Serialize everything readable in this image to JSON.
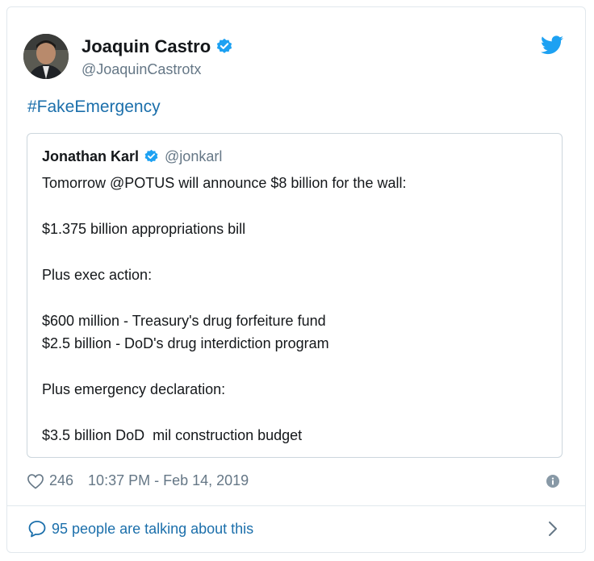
{
  "author": {
    "name": "Joaquin Castro",
    "handle": "@JoaquinCastrotx"
  },
  "tweet_text": "#FakeEmergency",
  "quoted": {
    "name": "Jonathan Karl",
    "handle": "@jonkarl",
    "lines": [
      "Tomorrow @POTUS will announce $8 billion for the wall:",
      "$1.375 billion appropriations bill",
      "Plus exec action:",
      "$600 million - Treasury's drug forfeiture fund",
      "$2.5 billion - DoD's drug interdiction program",
      "Plus emergency declaration:",
      "$3.5 billion DoD  mil construction budget"
    ]
  },
  "likes": "246",
  "timestamp": "10:37 PM - Feb 14, 2019",
  "talking": "95 people are talking about this",
  "colors": {
    "link": "#1b6fab",
    "verified": "#1da1f2",
    "muted": "#657786",
    "border": "#e1e8ed"
  },
  "icons": [
    "verified-badge-icon",
    "twitter-bird-icon",
    "heart-icon",
    "info-icon",
    "comment-bubble-icon",
    "chevron-right-icon"
  ]
}
